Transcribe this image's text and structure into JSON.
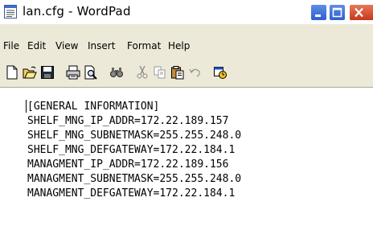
{
  "window": {
    "title": "lan.cfg - WordPad"
  },
  "menubar": {
    "items": [
      "File",
      "Edit",
      "View",
      "Insert",
      "Format",
      "Help"
    ]
  },
  "toolbar": {
    "buttons": [
      "new-icon",
      "open-icon",
      "save-icon",
      "print-icon",
      "print-preview-icon",
      "find-icon",
      "cut-icon",
      "copy-icon",
      "paste-icon",
      "undo-icon",
      "date-time-icon"
    ]
  },
  "document": {
    "lines": [
      "[GENERAL INFORMATION]",
      "SHELF_MNG_IP_ADDR=172.22.189.157",
      "SHELF_MNG_SUBNETMASK=255.255.248.0",
      "SHELF_MNG_DEFGATEWAY=172.22.184.1",
      "MANAGMENT_IP_ADDR=172.22.189.156",
      "MANAGMENT_SUBNETMASK=255.255.248.0",
      "MANAGMENT_DEFGATEWAY=172.22.184.1"
    ]
  },
  "colors": {
    "titlebar_button_blue": "#3f6fd8",
    "close_button_red": "#d4502f",
    "chrome_beige": "#ece9d8"
  }
}
